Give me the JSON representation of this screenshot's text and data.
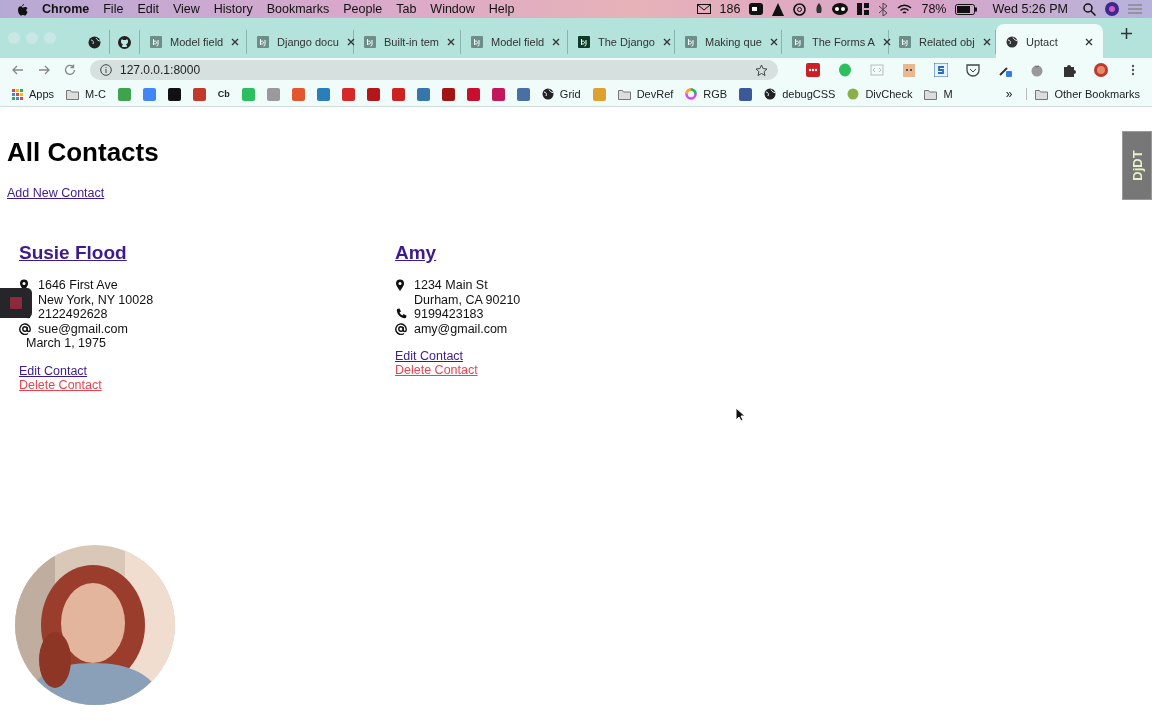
{
  "menu_bar": {
    "app": "Chrome",
    "items": [
      "File",
      "Edit",
      "View",
      "History",
      "Bookmarks",
      "People",
      "Tab",
      "Window",
      "Help"
    ],
    "mail_count": "186",
    "battery": "78%",
    "clock": "Wed 5:26 PM"
  },
  "tabs": [
    {
      "kind": "pinned",
      "selected": false
    },
    {
      "kind": "pinned",
      "selected": false
    },
    {
      "kind": "page",
      "title": "Model field",
      "selected": false
    },
    {
      "kind": "page",
      "title": "Django docu",
      "selected": false
    },
    {
      "kind": "page",
      "title": "Built-in tem",
      "selected": false
    },
    {
      "kind": "page",
      "title": "Model field",
      "selected": false
    },
    {
      "kind": "page",
      "title": "The Django",
      "selected": false
    },
    {
      "kind": "page",
      "title": "Making que",
      "selected": false
    },
    {
      "kind": "page",
      "title": "The Forms A",
      "selected": false
    },
    {
      "kind": "page",
      "title": "Related obj",
      "selected": false
    },
    {
      "kind": "page",
      "title": "Uptact",
      "selected": true
    }
  ],
  "address_bar": {
    "value": "127.0.0.1:8000"
  },
  "bookmarks": [
    {
      "kind": "apps",
      "label": "Apps"
    },
    {
      "kind": "folder",
      "label": "M-C"
    },
    {
      "kind": "site",
      "color": "#3fa34d"
    },
    {
      "kind": "site",
      "color": "#4285f4"
    },
    {
      "kind": "site",
      "color": "#111111"
    },
    {
      "kind": "site",
      "color": "#c0392b"
    },
    {
      "kind": "text",
      "label": "Cb"
    },
    {
      "kind": "site",
      "color": "#2dbe60"
    },
    {
      "kind": "site",
      "color": "#9a9a9a"
    },
    {
      "kind": "site",
      "color": "#e4572e"
    },
    {
      "kind": "site",
      "color": "#2a7fb8"
    },
    {
      "kind": "site",
      "color": "#d62828"
    },
    {
      "kind": "site",
      "color": "#b3161b"
    },
    {
      "kind": "site",
      "color": "#cc2222"
    },
    {
      "kind": "site",
      "color": "#3776ab"
    },
    {
      "kind": "site",
      "color": "#a31515"
    },
    {
      "kind": "site",
      "color": "#c8102e"
    },
    {
      "kind": "site",
      "color": "#c2185b"
    },
    {
      "kind": "site",
      "color": "#4a6fa5"
    },
    {
      "kind": "globe",
      "label": "Grid"
    },
    {
      "kind": "site",
      "color": "#e0a030"
    },
    {
      "kind": "folder",
      "label": "DevRef"
    },
    {
      "kind": "ring",
      "label": "RGB"
    },
    {
      "kind": "site",
      "color": "#3b5998"
    },
    {
      "kind": "globe",
      "label": "debugCSS"
    },
    {
      "kind": "dot",
      "label": "DivCheck"
    },
    {
      "kind": "folder",
      "label": "M"
    }
  ],
  "bookmarks_overflow": "»",
  "other_bookmarks": "Other Bookmarks",
  "page": {
    "title": "All Contacts",
    "add_link": "Add New Contact",
    "contacts": [
      {
        "name": "Susie Flood",
        "lines": [
          {
            "kind": "address",
            "text": "1646 First Ave"
          },
          {
            "kind": "address_cont",
            "text": "New York, NY 10028"
          },
          {
            "kind": "phone",
            "text": "2122492628"
          },
          {
            "kind": "email",
            "text": "sue@gmail.com"
          },
          {
            "kind": "birthday",
            "text": "March 1, 1975"
          }
        ],
        "edit": "Edit Contact",
        "delete": "Delete Contact"
      },
      {
        "name": "Amy",
        "lines": [
          {
            "kind": "address",
            "text": "1234 Main St"
          },
          {
            "kind": "address_cont",
            "text": "Durham, CA 90210"
          },
          {
            "kind": "phone",
            "text": "9199423183"
          },
          {
            "kind": "email",
            "text": "amy@gmail.com"
          }
        ],
        "edit": "Edit Contact",
        "delete": "Delete Contact"
      }
    ]
  },
  "debug_toolbar": {
    "label": "DjDT"
  }
}
